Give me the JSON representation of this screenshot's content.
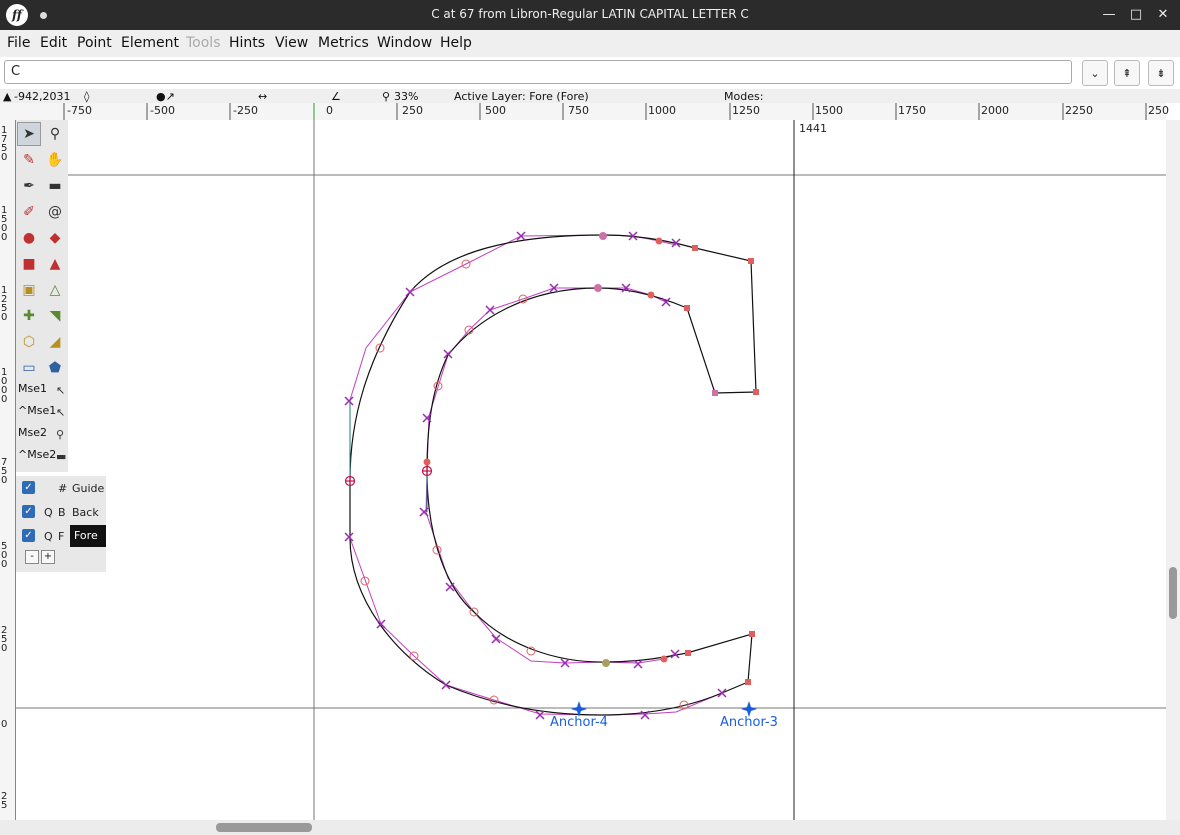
{
  "window": {
    "title": "C at 67 from Libron-Regular LATIN CAPITAL LETTER C",
    "logo": "ff",
    "controls": {
      "minimize": "—",
      "maximize": "□",
      "close": "✕"
    }
  },
  "menu": [
    "File",
    "Edit",
    "Point",
    "Element",
    "Tools",
    "Hints",
    "View",
    "Metrics",
    "Window",
    "Help"
  ],
  "glyph_field": {
    "value": "C"
  },
  "buttons": {
    "dropdown": "⌄",
    "prev": "⇞",
    "next": "⇟"
  },
  "info": {
    "coords": "-942,2031",
    "zoom": "33%",
    "active_layer": "Active Layer: Fore (Fore)",
    "modes": "Modes:"
  },
  "ruler_top_labels": [
    "-750",
    "-500",
    "-250",
    "0",
    "250",
    "500",
    "750",
    "1000",
    "1250",
    "1500",
    "1750",
    "2000",
    "2250",
    "250"
  ],
  "ruler_left_labels": [
    [
      "1",
      "7",
      "5",
      "0"
    ],
    [
      "1",
      "5",
      "0",
      "0"
    ],
    [
      "1",
      "2",
      "5",
      "0"
    ],
    [
      "1",
      "0",
      "0",
      "0"
    ],
    [
      "7",
      "5",
      "0"
    ],
    [
      "5",
      "0",
      "0"
    ],
    [
      "2",
      "5",
      "0"
    ],
    [
      "0"
    ],
    [
      "2",
      "5"
    ]
  ],
  "canvas": {
    "width_label": "1441",
    "anchors": [
      "Anchor-4",
      "Anchor-3"
    ]
  },
  "tools": {
    "mouse_labels": [
      "Mse1",
      "^Mse1",
      "Mse2",
      "^Mse2"
    ]
  },
  "layers": [
    {
      "q": "",
      "b": "#",
      "name": "Guide",
      "checked": true,
      "active": false
    },
    {
      "q": "Q",
      "b": "B",
      "name": "Back",
      "checked": true,
      "active": false
    },
    {
      "q": "Q",
      "b": "F",
      "name": "Fore",
      "checked": true,
      "active": true
    }
  ],
  "layer_buttons": [
    "-",
    "+"
  ],
  "check_mark": "✓"
}
